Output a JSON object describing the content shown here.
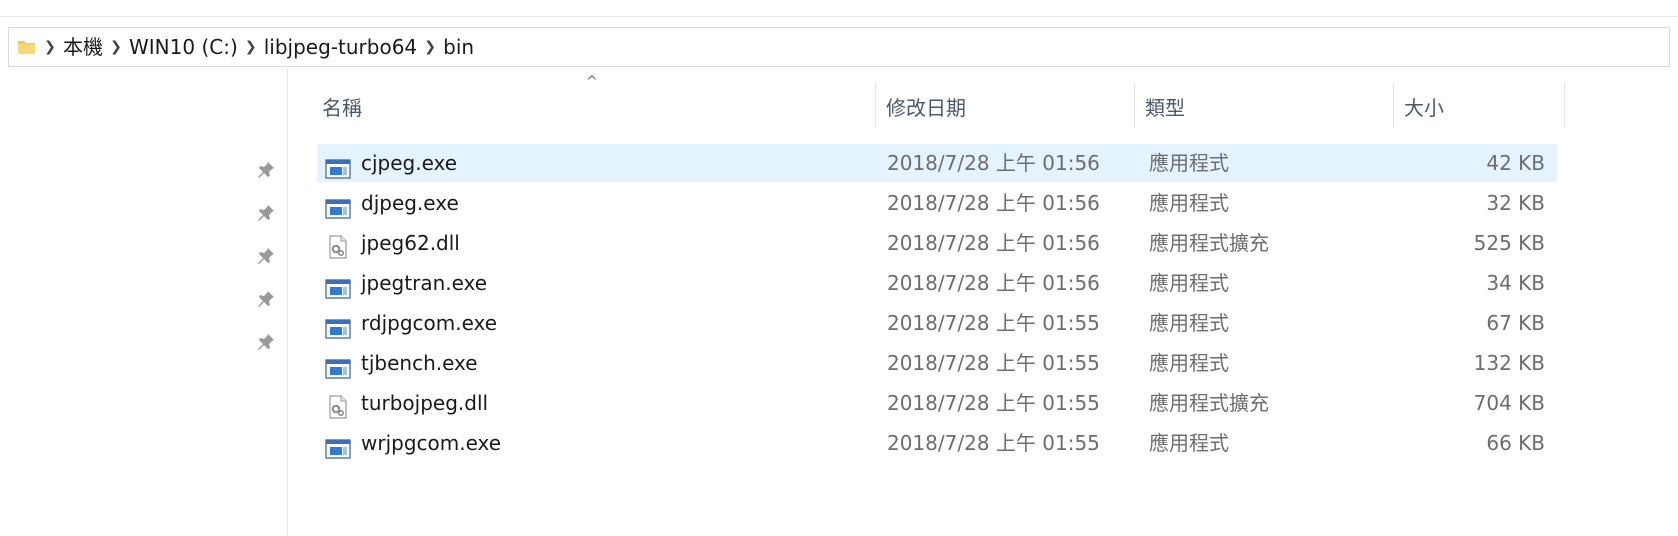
{
  "breadcrumb": {
    "items": [
      "本機",
      "WIN10 (C:)",
      "libjpeg-turbo64",
      "bin"
    ]
  },
  "columns": {
    "name": "名稱",
    "date": "修改日期",
    "type": "類型",
    "size": "大小"
  },
  "files": [
    {
      "name": "cjpeg.exe",
      "date": "2018/7/28 上午 01:56",
      "type": "應用程式",
      "size": "42 KB",
      "icon": "exe-icon",
      "selected": true
    },
    {
      "name": "djpeg.exe",
      "date": "2018/7/28 上午 01:56",
      "type": "應用程式",
      "size": "32 KB",
      "icon": "exe-icon",
      "selected": false
    },
    {
      "name": "jpeg62.dll",
      "date": "2018/7/28 上午 01:56",
      "type": "應用程式擴充",
      "size": "525 KB",
      "icon": "dll-icon",
      "selected": false
    },
    {
      "name": "jpegtran.exe",
      "date": "2018/7/28 上午 01:56",
      "type": "應用程式",
      "size": "34 KB",
      "icon": "exe-icon",
      "selected": false
    },
    {
      "name": "rdjpgcom.exe",
      "date": "2018/7/28 上午 01:55",
      "type": "應用程式",
      "size": "67 KB",
      "icon": "exe-icon",
      "selected": false
    },
    {
      "name": "tjbench.exe",
      "date": "2018/7/28 上午 01:55",
      "type": "應用程式",
      "size": "132 KB",
      "icon": "exe-icon",
      "selected": false
    },
    {
      "name": "turbojpeg.dll",
      "date": "2018/7/28 上午 01:55",
      "type": "應用程式擴充",
      "size": "704 KB",
      "icon": "dll-icon",
      "selected": false
    },
    {
      "name": "wrjpgcom.exe",
      "date": "2018/7/28 上午 01:55",
      "type": "應用程式",
      "size": "66 KB",
      "icon": "exe-icon",
      "selected": false
    }
  ],
  "colors": {
    "selected_row": "#e5f3ff",
    "header_text": "#4a5a6a",
    "meta_text": "#6d6d6d",
    "folder_yellow": "#f2c94c"
  },
  "icons": {
    "folder": "folder-icon",
    "pin": "pin-icon",
    "chevron": "chevron-right-icon",
    "sort": "sort-up-icon"
  }
}
